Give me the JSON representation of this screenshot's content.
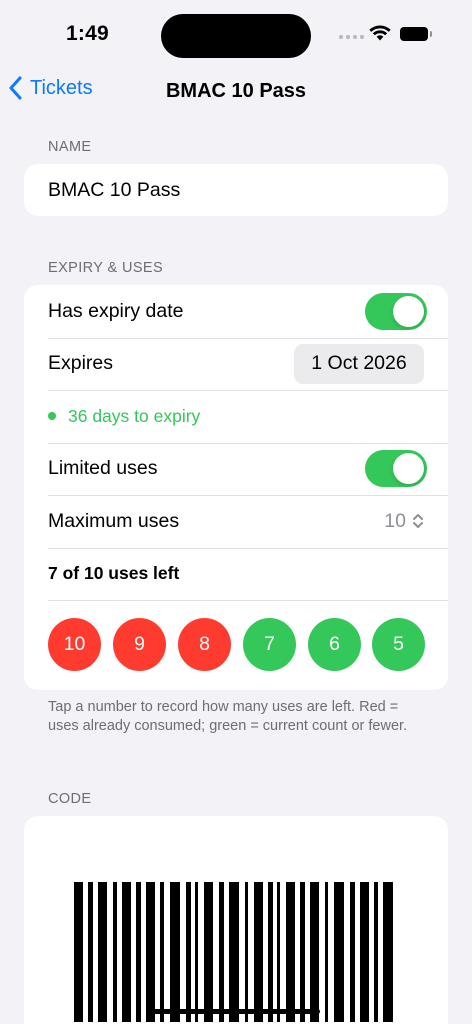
{
  "status_bar": {
    "time": "1:49"
  },
  "nav": {
    "back_label": "Tickets",
    "title": "BMAC 10 Pass"
  },
  "name_section": {
    "label": "NAME",
    "value": "BMAC 10 Pass"
  },
  "expiry_section": {
    "label": "EXPIRY & USES",
    "has_expiry_label": "Has expiry date",
    "has_expiry_on": true,
    "expires_label": "Expires",
    "expires_value": "1 Oct 2026",
    "expiry_status": "36 days to expiry",
    "limited_uses_label": "Limited uses",
    "limited_uses_on": true,
    "max_uses_label": "Maximum uses",
    "max_uses_value": "10",
    "uses_left_text": "7 of 10 uses left",
    "use_circles": [
      {
        "number": "10",
        "state": "consumed"
      },
      {
        "number": "9",
        "state": "consumed"
      },
      {
        "number": "8",
        "state": "consumed"
      },
      {
        "number": "7",
        "state": "current"
      },
      {
        "number": "6",
        "state": "current"
      },
      {
        "number": "5",
        "state": "current"
      }
    ]
  },
  "footnote": "Tap a number to record how many uses are left. Red = uses already consumed; green = current count or fewer.",
  "code_section": {
    "label": "CODE"
  },
  "colors": {
    "accent": "#0a7aff",
    "green": "#34c759",
    "red": "#ff3b30",
    "background": "#f2f2f7"
  }
}
